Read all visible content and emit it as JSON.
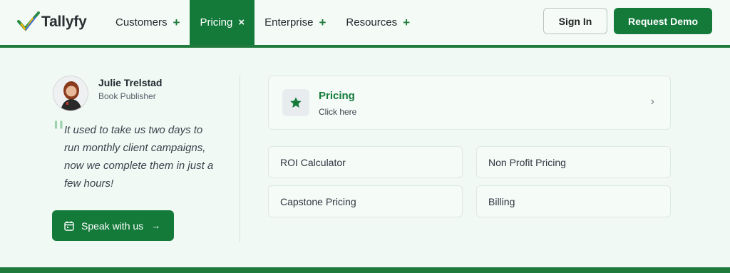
{
  "brand": {
    "name": "Tallyfy",
    "logo_icon": "tallyfy-check-logo-icon"
  },
  "nav": [
    {
      "label": "Customers",
      "icon": "+"
    },
    {
      "label": "Pricing",
      "icon": "×",
      "active": true
    },
    {
      "label": "Enterprise",
      "icon": "+"
    },
    {
      "label": "Resources",
      "icon": "+"
    }
  ],
  "header_actions": {
    "sign_in": "Sign In",
    "request_demo": "Request Demo"
  },
  "testimonial": {
    "name": "Julie Trelstad",
    "role": "Book Publisher",
    "quote": "It used to take us two days to run monthly client campaigns, now we complete them in just a few hours!",
    "quote_mark": "\""
  },
  "cta": {
    "label": "Speak with us",
    "icon": "calendar-icon",
    "arrow": "→"
  },
  "featured": {
    "title": "Pricing",
    "subtitle": "Click here",
    "icon": "star-icon",
    "chevron": "›"
  },
  "links": [
    "ROI Calculator",
    "Non Profit Pricing",
    "Capstone Pricing",
    "Billing"
  ],
  "colors": {
    "brand_green": "#137a3a",
    "background": "#f0f9f3",
    "accent_line": "#1f7a3c"
  }
}
